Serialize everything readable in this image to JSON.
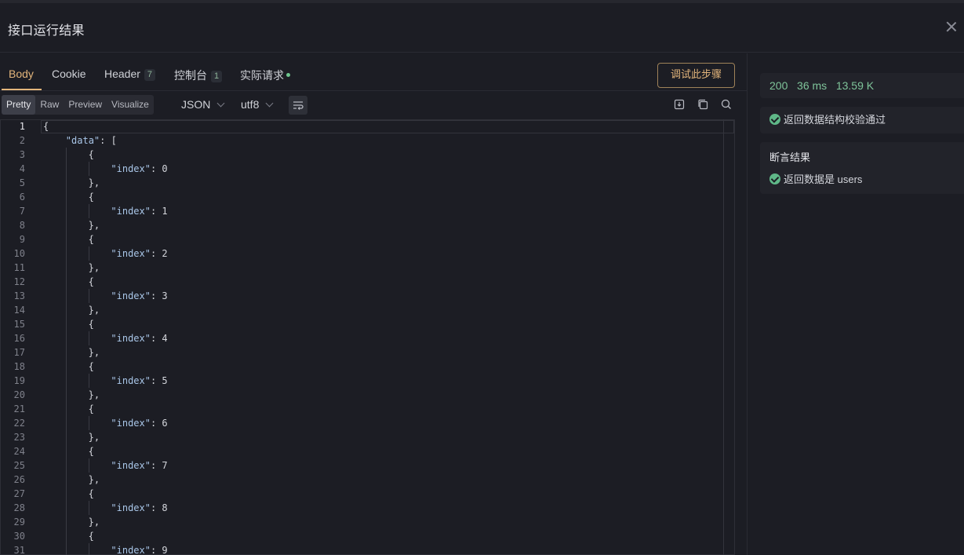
{
  "window": {
    "title": "接口运行结果"
  },
  "tabs": [
    {
      "label": "Body"
    },
    {
      "label": "Cookie"
    },
    {
      "label": "Header",
      "badge": "7"
    },
    {
      "label": "控制台",
      "badge": "1"
    },
    {
      "label": "实际请求"
    }
  ],
  "debug_button": "调试此步骤",
  "view_modes": [
    "Pretty",
    "Raw",
    "Preview",
    "Visualize"
  ],
  "format_select": "JSON",
  "encoding_select": "utf8",
  "icons": {
    "wrap": "text-wrap-icon",
    "download": "download-icon",
    "copy": "copy-icon",
    "search": "search-icon",
    "close": "close-icon",
    "check": "check-circle-icon"
  },
  "colors": {
    "accent": "#e3b57b",
    "success": "#7fc49a",
    "background": "#1c1d24"
  },
  "editor": {
    "lines": [
      {
        "n": "1",
        "text": "{"
      },
      {
        "n": "2",
        "key": "\"data\"",
        "text": ": ["
      },
      {
        "n": "3",
        "text": "{"
      },
      {
        "n": "4",
        "key": "\"index\"",
        "text": ": 0"
      },
      {
        "n": "5",
        "text": "},"
      },
      {
        "n": "6",
        "text": "{"
      },
      {
        "n": "7",
        "key": "\"index\"",
        "text": ": 1"
      },
      {
        "n": "8",
        "text": "},"
      },
      {
        "n": "9",
        "text": "{"
      },
      {
        "n": "10",
        "key": "\"index\"",
        "text": ": 2"
      },
      {
        "n": "11",
        "text": "},"
      },
      {
        "n": "12",
        "text": "{"
      },
      {
        "n": "13",
        "key": "\"index\"",
        "text": ": 3"
      },
      {
        "n": "14",
        "text": "},"
      },
      {
        "n": "15",
        "text": "{"
      },
      {
        "n": "16",
        "key": "\"index\"",
        "text": ": 4"
      },
      {
        "n": "17",
        "text": "},"
      },
      {
        "n": "18",
        "text": "{"
      },
      {
        "n": "19",
        "key": "\"index\"",
        "text": ": 5"
      },
      {
        "n": "20",
        "text": "},"
      },
      {
        "n": "21",
        "text": "{"
      },
      {
        "n": "22",
        "key": "\"index\"",
        "text": ": 6"
      },
      {
        "n": "23",
        "text": "},"
      },
      {
        "n": "24",
        "text": "{"
      },
      {
        "n": "25",
        "key": "\"index\"",
        "text": ": 7"
      },
      {
        "n": "26",
        "text": "},"
      },
      {
        "n": "27",
        "text": "{"
      },
      {
        "n": "28",
        "key": "\"index\"",
        "text": ": 8"
      },
      {
        "n": "29",
        "text": "},"
      },
      {
        "n": "30",
        "text": "{"
      },
      {
        "n": "31",
        "key": "\"index\"",
        "text": ": 9"
      }
    ]
  },
  "response": {
    "status": "200",
    "time": "36 ms",
    "size": "13.59 K"
  },
  "schema_check": "返回数据结构校验通过",
  "assertions": {
    "title": "断言结果",
    "items": [
      "返回数据是 users"
    ]
  }
}
